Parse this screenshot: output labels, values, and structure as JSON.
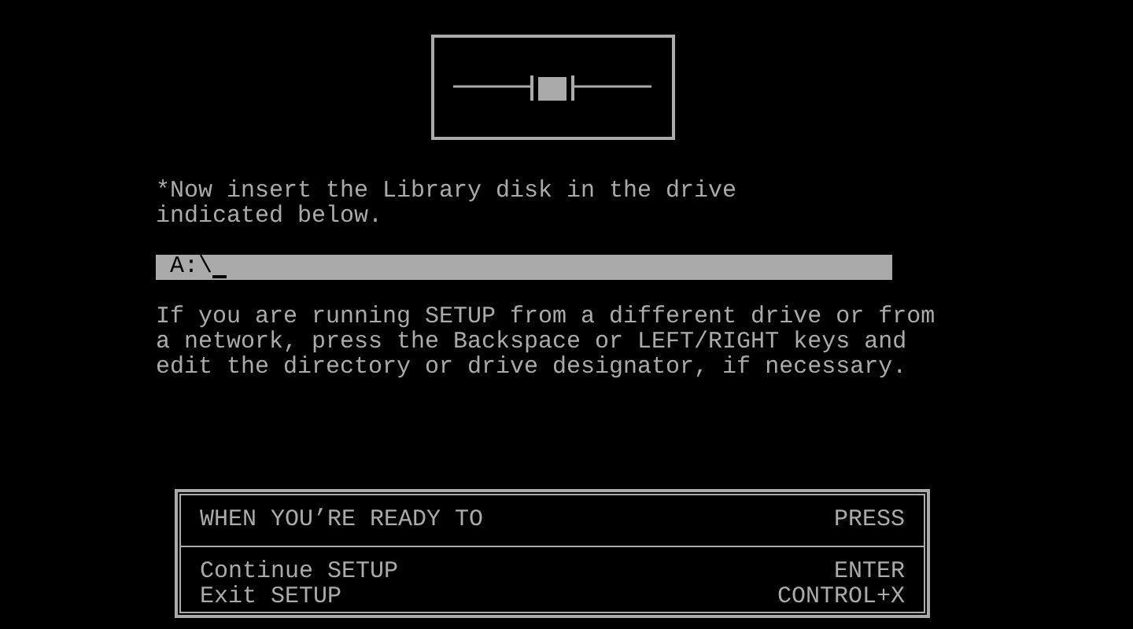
{
  "instruction": [
    "*Now insert the Library disk in the drive",
    "indicated below."
  ],
  "drive_field": {
    "value": "A:\\"
  },
  "help": [
    "If you are running SETUP from a different drive or from",
    "a network, press the Backspace or LEFT/RIGHT keys and",
    "edit the directory or drive designator, if necessary."
  ],
  "key_table": {
    "header": {
      "action": "WHEN YOU’RE READY TO",
      "key": "PRESS"
    },
    "rows": [
      {
        "action": "Continue SETUP",
        "key": "ENTER"
      },
      {
        "action": "Exit SETUP",
        "key": "CONTROL+X"
      }
    ]
  }
}
